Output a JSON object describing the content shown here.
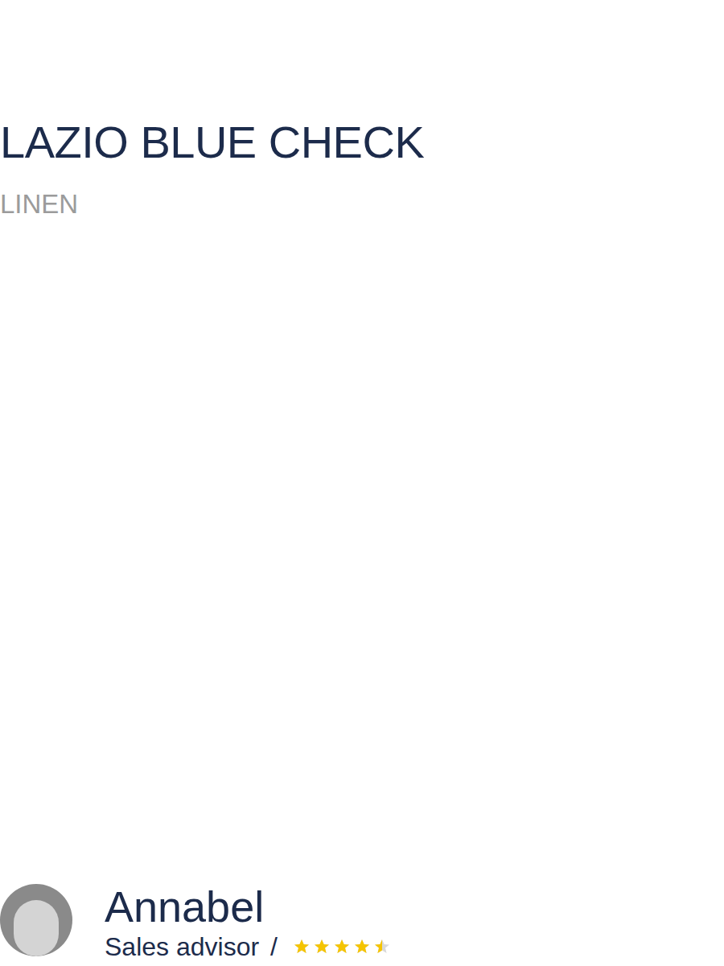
{
  "product": {
    "title": "LAZIO BLUE CHECK",
    "material": "LINEN"
  },
  "advisor": {
    "name": "Annabel",
    "role": "Sales advisor",
    "separator": "/",
    "stars": 4.5
  }
}
